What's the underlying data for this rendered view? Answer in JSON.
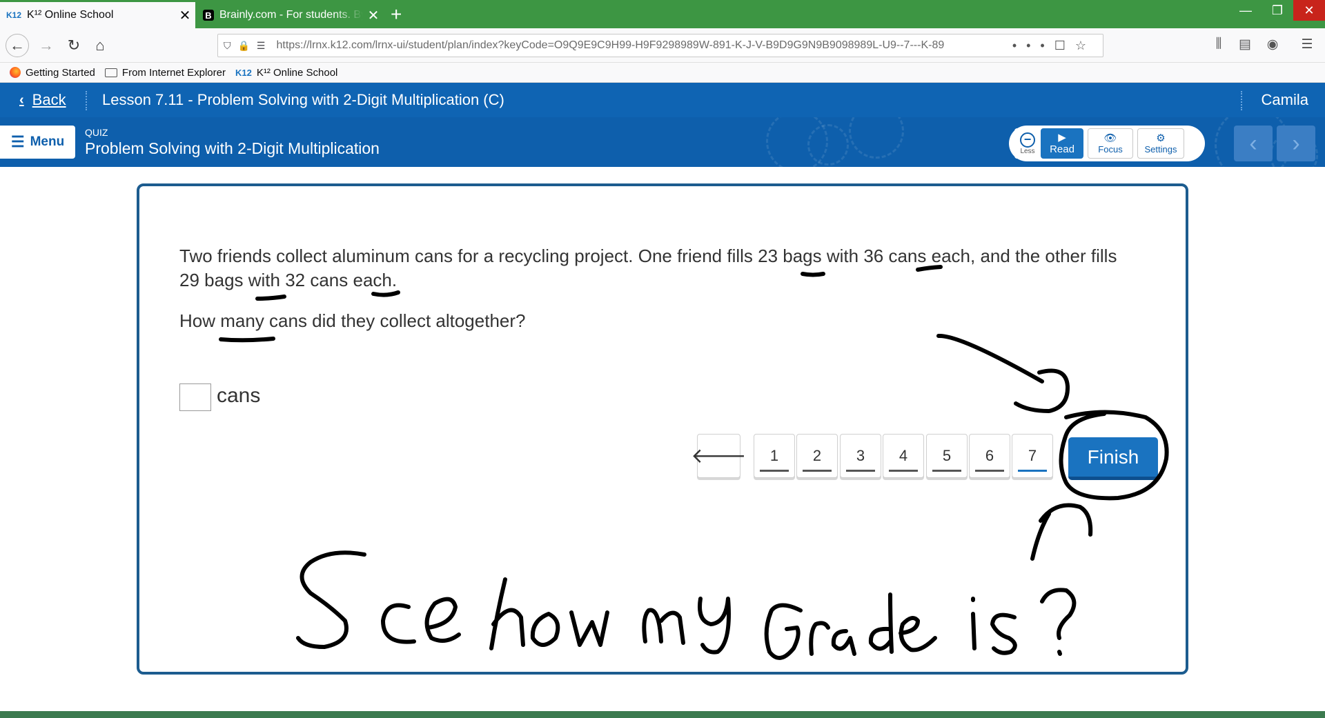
{
  "browser": {
    "tabs": [
      {
        "icon": "K12",
        "title": "K¹² Online School",
        "active": true
      },
      {
        "icon": "B",
        "title": "Brainly.com - For students. By students",
        "active": false
      }
    ],
    "url": "https://lrnx.k12.com/lrnx-ui/student/plan/index?keyCode=O9Q9E9C9H99-H9F9298989W-891-K-J-V-B9D9G9N9B9098989L-U9--7---K-89",
    "bookmarks": [
      "Getting Started",
      "From Internet Explorer",
      "K¹² Online School"
    ]
  },
  "header": {
    "back_label": "Back",
    "lesson_title": "Lesson 7.11 - Problem Solving with 2-Digit Multiplication (C)",
    "user_name": "Camila"
  },
  "subheader": {
    "menu_label": "Menu",
    "quiz_label": "QUIZ",
    "quiz_title": "Problem Solving with 2-Digit Multiplication",
    "tools": {
      "less": "Less",
      "read": "Read",
      "focus": "Focus",
      "settings": "Settings"
    }
  },
  "question": {
    "text": "Two friends collect aluminum cans for a recycling project. One friend fills 23 bags with 36 cans each, and the other fills 29 bags with 32 cans each.",
    "ask": "How many cans did they collect altogether?",
    "answer_value": "",
    "answer_unit": "cans"
  },
  "pager": {
    "pages": [
      "1",
      "2",
      "3",
      "4",
      "5",
      "6",
      "7"
    ],
    "current": "7",
    "finish_label": "Finish"
  },
  "annotation": {
    "handwriting": "See how my Grade is?",
    "ink_color": "#000000"
  },
  "colors": {
    "k12_blue": "#0f64b3",
    "browser_green": "#3d9643",
    "finish_blue": "#1a73c0",
    "frame_border": "#1c5c8f"
  }
}
